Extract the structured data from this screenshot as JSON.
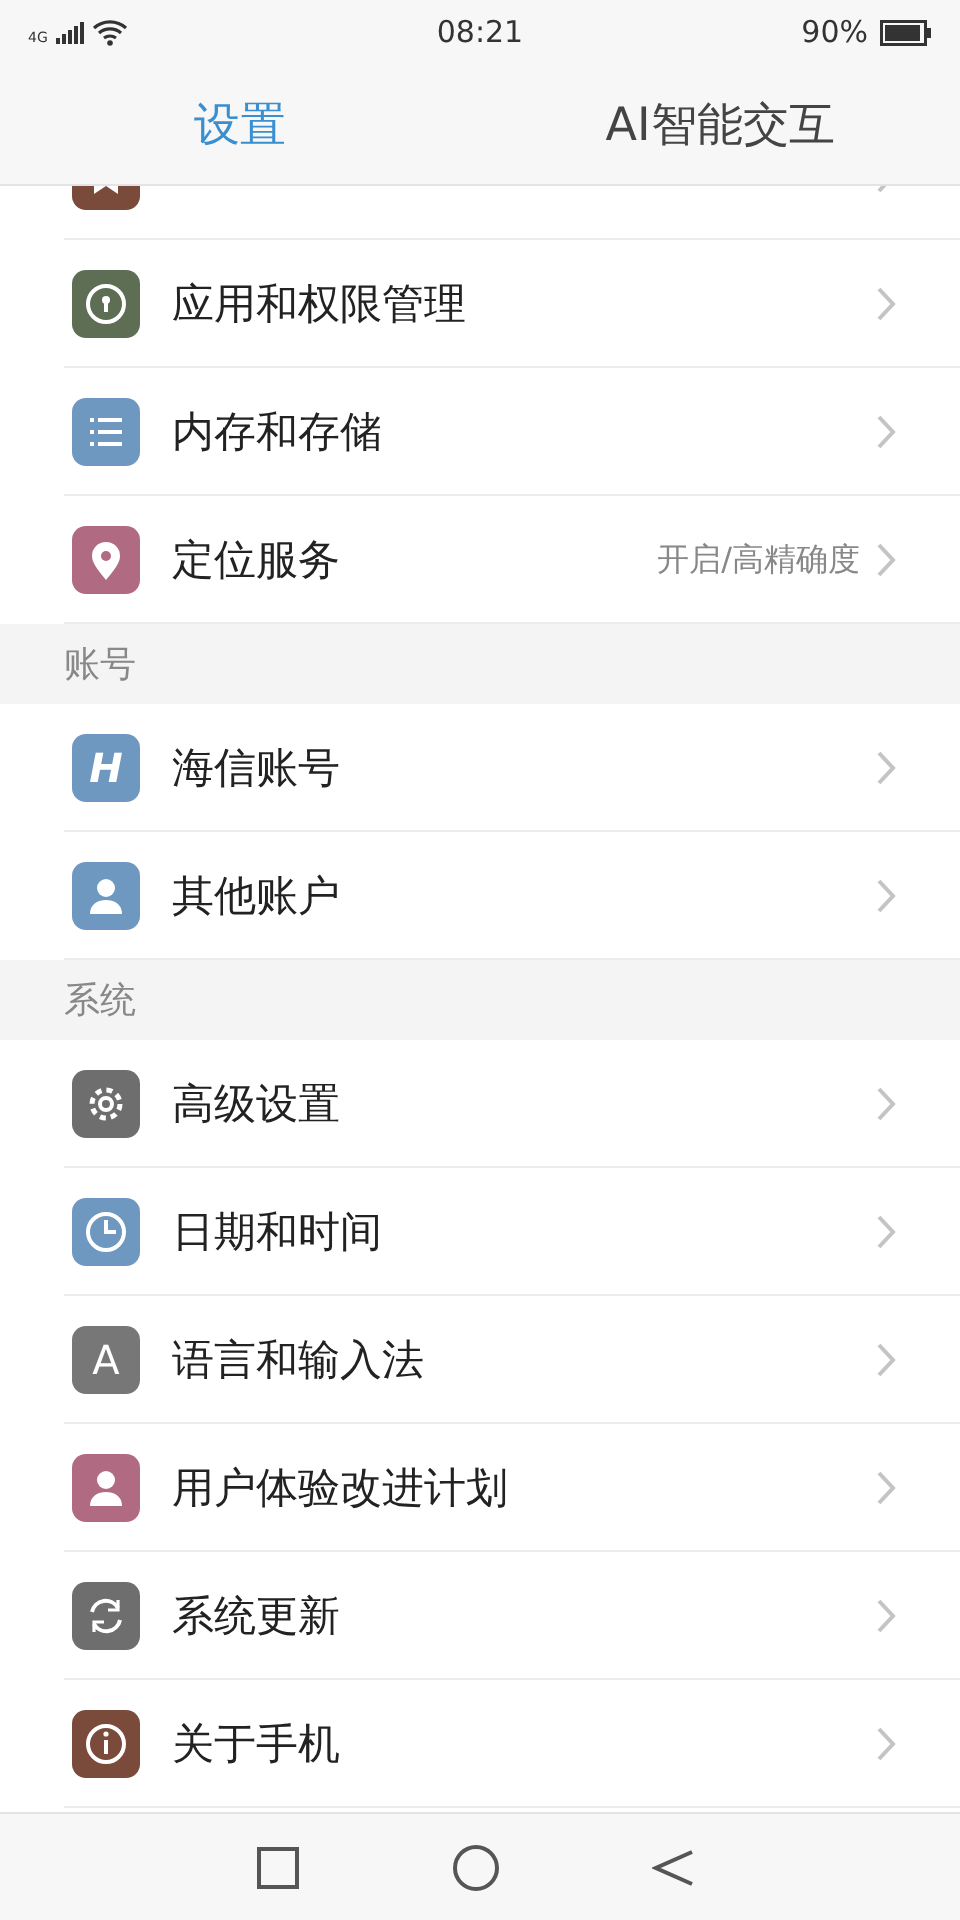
{
  "status_bar": {
    "network": "4G",
    "time": "08:21",
    "battery": "90%"
  },
  "tabs": [
    {
      "label": "设置",
      "selected": true
    },
    {
      "label": "AI智能交互",
      "selected": false
    }
  ],
  "sections": [
    {
      "items": [
        {
          "color": "#7a4a3a"
        },
        {
          "label": "应用和权限管理",
          "color": "#5d6e55"
        },
        {
          "label": "内存和存储",
          "color": "#6f98c0"
        },
        {
          "label": "定位服务",
          "value": "开启/高精确度",
          "color": "#b06a82"
        }
      ]
    },
    {
      "header": "账号",
      "items": [
        {
          "label": "海信账号",
          "color": "#6f98c0",
          "glyph": "H"
        },
        {
          "label": "其他账户",
          "color": "#6f98c0"
        }
      ]
    },
    {
      "header": "系统",
      "items": [
        {
          "label": "高级设置",
          "color": "#6e6e6e"
        },
        {
          "label": "日期和时间",
          "color": "#6f98c0"
        },
        {
          "label": "语言和输入法",
          "color": "#777777",
          "glyph": "A"
        },
        {
          "label": "用户体验改进计划",
          "color": "#b06a82"
        },
        {
          "label": "系统更新",
          "color": "#6e6e6e"
        },
        {
          "label": "关于手机",
          "color": "#7a4a3a"
        }
      ]
    }
  ]
}
